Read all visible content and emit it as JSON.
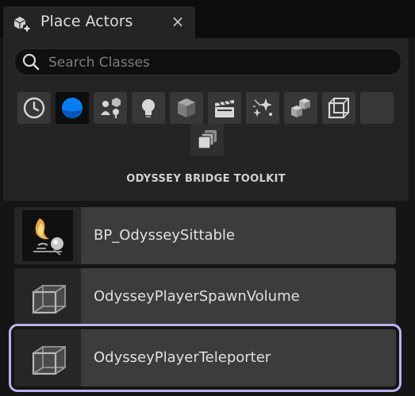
{
  "tab": {
    "title": "Place Actors",
    "close_glyph": "×",
    "icon": "place-actors-icon"
  },
  "search": {
    "placeholder": "Search Classes",
    "value": ""
  },
  "categories": [
    {
      "name": "recently-placed",
      "icon": "clock-icon"
    },
    {
      "name": "get-started",
      "icon": "blue-sphere-icon",
      "selected": true
    },
    {
      "name": "basic",
      "icon": "basic-shapes-icon"
    },
    {
      "name": "lights",
      "icon": "lightbulb-icon"
    },
    {
      "name": "shapes",
      "icon": "cube-icon"
    },
    {
      "name": "cinematic",
      "icon": "clapperboard-icon"
    },
    {
      "name": "visual-effects",
      "icon": "sparkles-icon"
    },
    {
      "name": "geometry",
      "icon": "stacked-cubes-icon"
    },
    {
      "name": "volumes",
      "icon": "wire-cube-icon"
    },
    {
      "name": "all-classes",
      "icon": "blank-icon"
    },
    {
      "name": "odyssey-bridge-toolkit",
      "icon": "stacked-frames-icon",
      "selected": true
    }
  ],
  "section_title": "ODYSSEY BRIDGE TOOLKIT",
  "items": [
    {
      "label": "BP_OdysseySittable",
      "icon": "sittable-thumbnail-icon",
      "selected": false
    },
    {
      "label": "OdysseyPlayerSpawnVolume",
      "icon": "wire-cube-icon",
      "selected": false
    },
    {
      "label": "OdysseyPlayerTeleporter",
      "icon": "wire-cube-icon",
      "selected": true
    }
  ],
  "colors": {
    "background": "#151515",
    "panel": "#242424",
    "row": "#3c3c3c",
    "selection_outline": "#b9b2f2",
    "accent_blue": "#0a7cf2"
  }
}
